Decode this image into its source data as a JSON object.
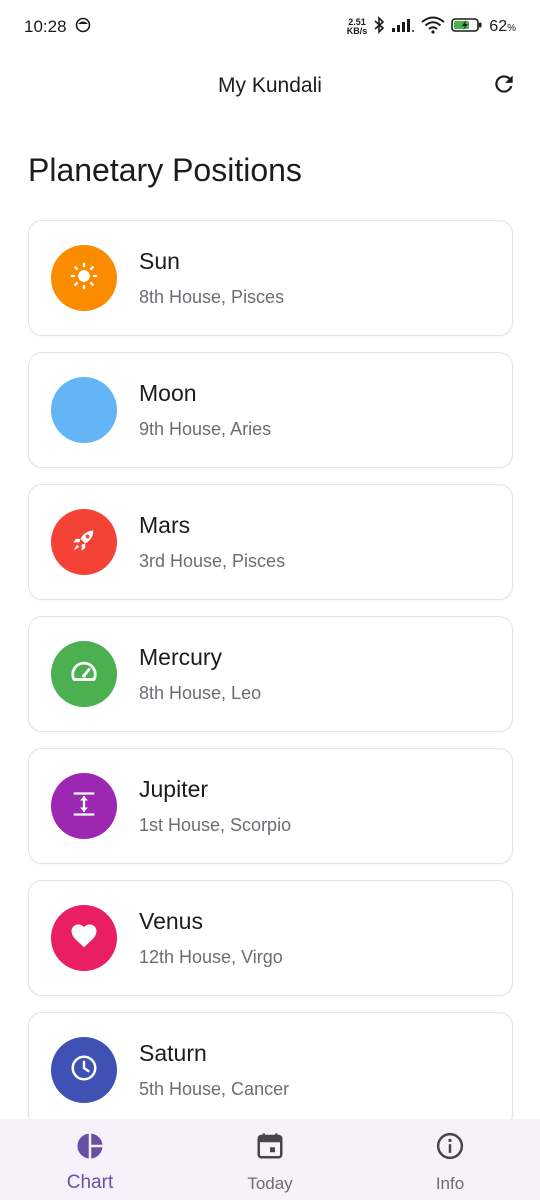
{
  "status_bar": {
    "time": "10:28",
    "net_speed_value": "2.51",
    "net_speed_unit": "KB/s",
    "battery_percent": "62"
  },
  "app_bar": {
    "title": "My Kundali"
  },
  "section_title": "Planetary Positions",
  "planets": [
    {
      "name": "Sun",
      "detail": "8th House, Pisces",
      "color": "#fb8c00",
      "icon": "sun-icon"
    },
    {
      "name": "Moon",
      "detail": "9th House, Aries",
      "color": "#64b5f6",
      "icon": "crescent-moon-icon"
    },
    {
      "name": "Mars",
      "detail": "3rd House, Pisces",
      "color": "#f44336",
      "icon": "rocket-icon"
    },
    {
      "name": "Mercury",
      "detail": "8th House, Leo",
      "color": "#4caf50",
      "icon": "speedometer-icon"
    },
    {
      "name": "Jupiter",
      "detail": "1st House, Scorpio",
      "color": "#9c27b0",
      "icon": "vertical-expand-icon"
    },
    {
      "name": "Venus",
      "detail": "12th House, Virgo",
      "color": "#e91e63",
      "icon": "heart-icon"
    },
    {
      "name": "Saturn",
      "detail": "5th House, Cancer",
      "color": "#3f51b5",
      "icon": "clock-icon"
    }
  ],
  "bottom_nav": {
    "items": [
      {
        "label": "Chart",
        "icon": "pie-chart-icon",
        "active": true
      },
      {
        "label": "Today",
        "icon": "calendar-icon",
        "active": false
      },
      {
        "label": "Info",
        "icon": "info-icon",
        "active": false
      }
    ]
  },
  "colors": {
    "accent": "#6750a4",
    "nav_background": "#f7f1fb"
  }
}
